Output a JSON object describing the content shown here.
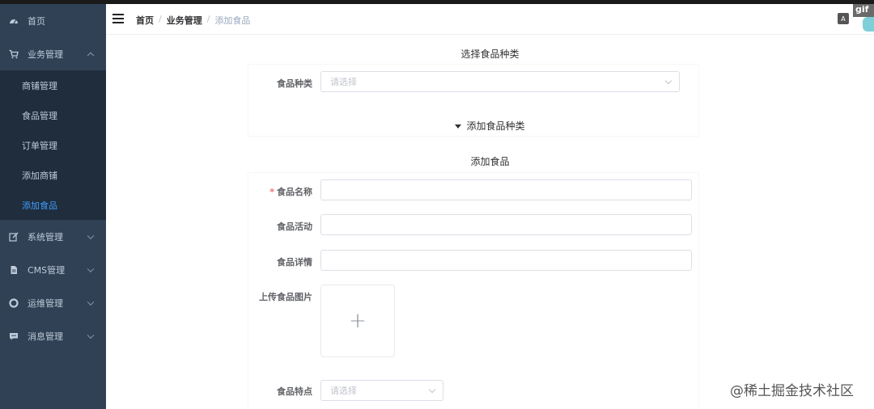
{
  "sidebar": {
    "items": [
      {
        "label": "首页",
        "icon": "dashboard-icon"
      },
      {
        "label": "业务管理",
        "icon": "cart-icon",
        "expanded": true
      },
      {
        "label": "系统管理",
        "icon": "edit-icon"
      },
      {
        "label": "CMS管理",
        "icon": "document-icon"
      },
      {
        "label": "运维管理",
        "icon": "lifebuoy-icon"
      },
      {
        "label": "消息管理",
        "icon": "message-icon"
      }
    ],
    "submenu": [
      {
        "label": "商铺管理"
      },
      {
        "label": "食品管理"
      },
      {
        "label": "订单管理"
      },
      {
        "label": "添加商铺"
      },
      {
        "label": "添加食品",
        "active": true
      }
    ]
  },
  "header": {
    "breadcrumb": [
      "首页",
      "业务管理",
      "添加食品"
    ],
    "separator": "/",
    "lang_icon": "A",
    "gif_badge": "gif"
  },
  "category_section": {
    "title": "选择食品种类",
    "label": "食品种类",
    "placeholder": "请选择",
    "collapse_label": "添加食品种类"
  },
  "food_section": {
    "title": "添加食品",
    "name_label": "食品名称",
    "required_mark": "*",
    "activity_label": "食品活动",
    "detail_label": "食品详情",
    "upload_label": "上传食品图片",
    "upload_plus": "+",
    "feature_label": "食品特点",
    "feature_placeholder": "请选择"
  },
  "watermark": "@稀土掘金技术社区",
  "colors": {
    "sidebar_bg": "#304156",
    "submenu_bg": "#1f2d3d",
    "active": "#409eff"
  }
}
